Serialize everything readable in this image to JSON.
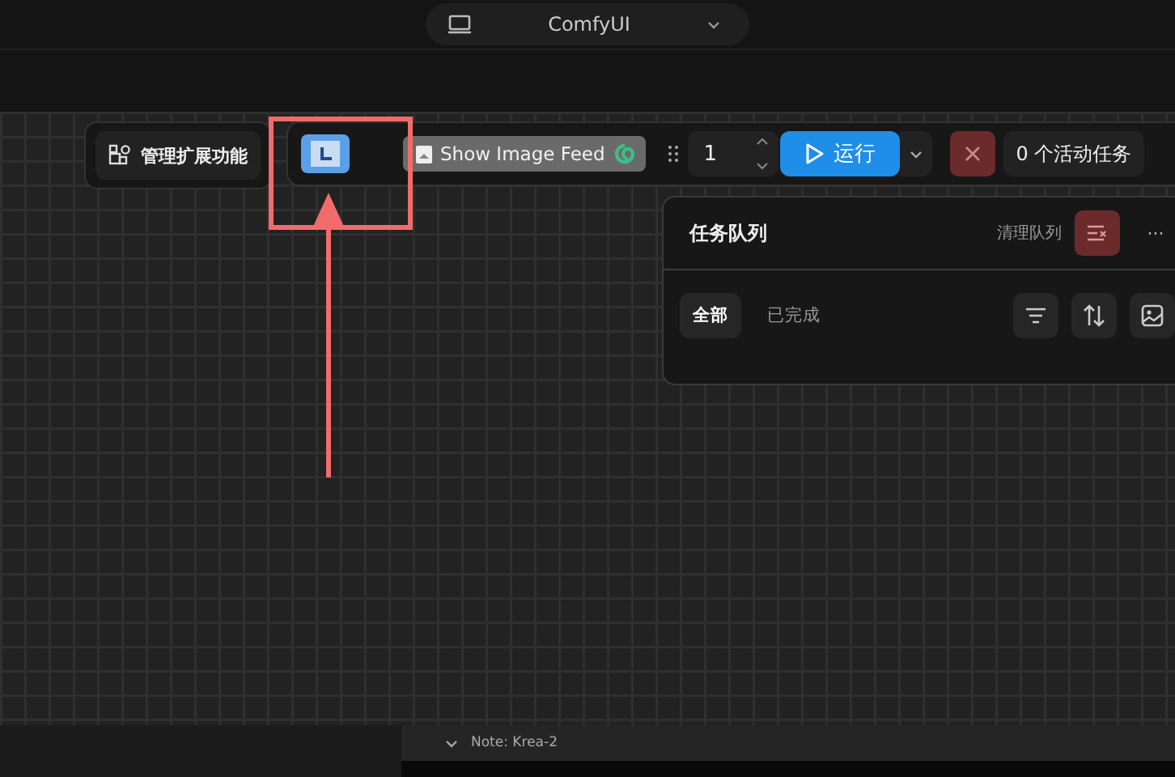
{
  "window": {
    "title": "ComfyUI"
  },
  "toolbar": {
    "extensions_button": "管理扩展功能",
    "image_feed_button": "Show Image Feed",
    "batch_count": "1",
    "run_button": "运行",
    "active_tasks": "0 个活动任务"
  },
  "queue_panel": {
    "title": "任务队列",
    "clear_button": "清理队列",
    "more_button": "···",
    "tabs": [
      {
        "label": "全部",
        "selected": true
      },
      {
        "label": "已完成",
        "selected": false
      }
    ]
  },
  "bottom_panel": {
    "note_title": "Note: Krea-2",
    "expanded": true
  },
  "annotation": {
    "shown": true
  }
}
